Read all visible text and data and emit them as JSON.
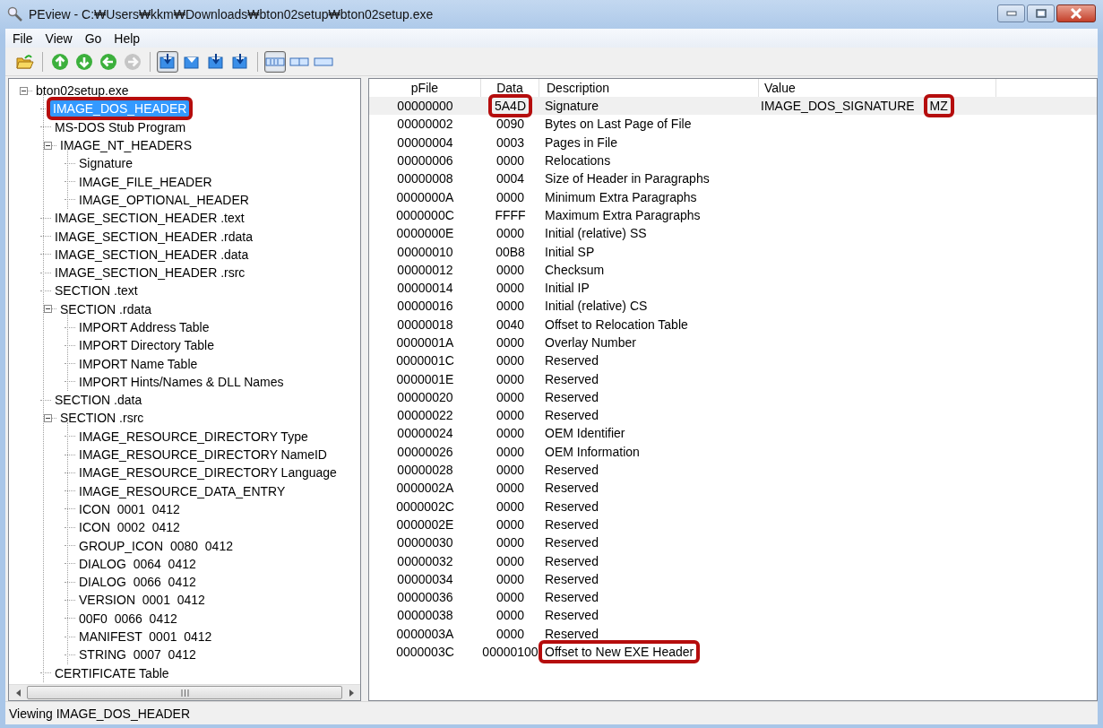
{
  "window": {
    "title": "PEview - C:₩Users₩kkm₩Downloads₩bton02setup₩bton02setup.exe"
  },
  "menu": [
    "File",
    "View",
    "Go",
    "Help"
  ],
  "toolbar": [
    {
      "pressed": false,
      "disabled": false
    },
    {
      "pressed": false,
      "disabled": false
    },
    {
      "pressed": false,
      "disabled": false
    },
    {
      "pressed": false,
      "disabled": false
    },
    {
      "pressed": false,
      "disabled": true
    },
    {
      "pressed": true,
      "disabled": false
    },
    {
      "pressed": false,
      "disabled": false
    },
    {
      "pressed": false,
      "disabled": false
    },
    {
      "pressed": false,
      "disabled": false
    },
    {
      "pressed": true,
      "disabled": false
    },
    {
      "pressed": false,
      "disabled": false
    },
    {
      "pressed": false,
      "disabled": false
    }
  ],
  "tree": [
    {
      "label": "bton02setup.exe",
      "selected": false,
      "marked": false,
      "expanded": true,
      "children": [
        {
          "label": "IMAGE_DOS_HEADER",
          "selected": true,
          "marked": true
        },
        {
          "label": "MS-DOS Stub Program",
          "selected": false,
          "marked": false
        },
        {
          "label": "IMAGE_NT_HEADERS",
          "selected": false,
          "marked": false,
          "expanded": true,
          "children": [
            {
              "label": "Signature",
              "selected": false,
              "marked": false
            },
            {
              "label": "IMAGE_FILE_HEADER",
              "selected": false,
              "marked": false
            },
            {
              "label": "IMAGE_OPTIONAL_HEADER",
              "selected": false,
              "marked": false
            }
          ]
        },
        {
          "label": "IMAGE_SECTION_HEADER .text",
          "selected": false,
          "marked": false
        },
        {
          "label": "IMAGE_SECTION_HEADER .rdata",
          "selected": false,
          "marked": false
        },
        {
          "label": "IMAGE_SECTION_HEADER .data",
          "selected": false,
          "marked": false
        },
        {
          "label": "IMAGE_SECTION_HEADER .rsrc",
          "selected": false,
          "marked": false
        },
        {
          "label": "SECTION .text",
          "selected": false,
          "marked": false
        },
        {
          "label": "SECTION .rdata",
          "selected": false,
          "marked": false,
          "expanded": true,
          "children": [
            {
              "label": "IMPORT Address Table",
              "selected": false,
              "marked": false
            },
            {
              "label": "IMPORT Directory Table",
              "selected": false,
              "marked": false
            },
            {
              "label": "IMPORT Name Table",
              "selected": false,
              "marked": false
            },
            {
              "label": "IMPORT Hints/Names & DLL Names",
              "selected": false,
              "marked": false
            }
          ]
        },
        {
          "label": "SECTION .data",
          "selected": false,
          "marked": false
        },
        {
          "label": "SECTION .rsrc",
          "selected": false,
          "marked": false,
          "expanded": true,
          "children": [
            {
              "label": "IMAGE_RESOURCE_DIRECTORY Type",
              "selected": false,
              "marked": false
            },
            {
              "label": "IMAGE_RESOURCE_DIRECTORY NameID",
              "selected": false,
              "marked": false
            },
            {
              "label": "IMAGE_RESOURCE_DIRECTORY Language",
              "selected": false,
              "marked": false
            },
            {
              "label": "IMAGE_RESOURCE_DATA_ENTRY",
              "selected": false,
              "marked": false
            },
            {
              "label": "ICON  0001  0412",
              "selected": false,
              "marked": false
            },
            {
              "label": "ICON  0002  0412",
              "selected": false,
              "marked": false
            },
            {
              "label": "GROUP_ICON  0080  0412",
              "selected": false,
              "marked": false
            },
            {
              "label": "DIALOG  0064  0412",
              "selected": false,
              "marked": false
            },
            {
              "label": "DIALOG  0066  0412",
              "selected": false,
              "marked": false
            },
            {
              "label": "VERSION  0001  0412",
              "selected": false,
              "marked": false
            },
            {
              "label": "00F0  0066  0412",
              "selected": false,
              "marked": false
            },
            {
              "label": "MANIFEST  0001  0412",
              "selected": false,
              "marked": false
            },
            {
              "label": "STRING  0007  0412",
              "selected": false,
              "marked": false
            }
          ]
        },
        {
          "label": "CERTIFICATE Table",
          "selected": false,
          "marked": false
        }
      ]
    }
  ],
  "table": {
    "columns": [
      "pFile",
      "Data",
      "Description",
      "Value"
    ],
    "rows": [
      {
        "pfile": "00000000",
        "data": "5A4D",
        "description": "Signature",
        "value": "IMAGE_DOS_SIGNATURE",
        "value_2": "MZ",
        "selected": true,
        "data_marked": true,
        "description_marked": false,
        "value_marked": true
      },
      {
        "pfile": "00000002",
        "data": "0090",
        "description": "Bytes on Last Page of File",
        "selected": false,
        "data_marked": false,
        "description_marked": false
      },
      {
        "pfile": "00000004",
        "data": "0003",
        "description": "Pages in File",
        "selected": false,
        "data_marked": false,
        "description_marked": false
      },
      {
        "pfile": "00000006",
        "data": "0000",
        "description": "Relocations",
        "selected": false,
        "data_marked": false,
        "description_marked": false
      },
      {
        "pfile": "00000008",
        "data": "0004",
        "description": "Size of Header in Paragraphs",
        "selected": false,
        "data_marked": false,
        "description_marked": false
      },
      {
        "pfile": "0000000A",
        "data": "0000",
        "description": "Minimum Extra Paragraphs",
        "selected": false,
        "data_marked": false,
        "description_marked": false
      },
      {
        "pfile": "0000000C",
        "data": "FFFF",
        "description": "Maximum Extra Paragraphs",
        "selected": false,
        "data_marked": false,
        "description_marked": false
      },
      {
        "pfile": "0000000E",
        "data": "0000",
        "description": "Initial (relative) SS",
        "selected": false,
        "data_marked": false,
        "description_marked": false
      },
      {
        "pfile": "00000010",
        "data": "00B8",
        "description": "Initial SP",
        "selected": false,
        "data_marked": false,
        "description_marked": false
      },
      {
        "pfile": "00000012",
        "data": "0000",
        "description": "Checksum",
        "selected": false,
        "data_marked": false,
        "description_marked": false
      },
      {
        "pfile": "00000014",
        "data": "0000",
        "description": "Initial IP",
        "selected": false,
        "data_marked": false,
        "description_marked": false
      },
      {
        "pfile": "00000016",
        "data": "0000",
        "description": "Initial (relative) CS",
        "selected": false,
        "data_marked": false,
        "description_marked": false
      },
      {
        "pfile": "00000018",
        "data": "0040",
        "description": "Offset to Relocation Table",
        "selected": false,
        "data_marked": false,
        "description_marked": false
      },
      {
        "pfile": "0000001A",
        "data": "0000",
        "description": "Overlay Number",
        "selected": false,
        "data_marked": false,
        "description_marked": false
      },
      {
        "pfile": "0000001C",
        "data": "0000",
        "description": "Reserved",
        "selected": false,
        "data_marked": false,
        "description_marked": false
      },
      {
        "pfile": "0000001E",
        "data": "0000",
        "description": "Reserved",
        "selected": false,
        "data_marked": false,
        "description_marked": false
      },
      {
        "pfile": "00000020",
        "data": "0000",
        "description": "Reserved",
        "selected": false,
        "data_marked": false,
        "description_marked": false
      },
      {
        "pfile": "00000022",
        "data": "0000",
        "description": "Reserved",
        "selected": false,
        "data_marked": false,
        "description_marked": false
      },
      {
        "pfile": "00000024",
        "data": "0000",
        "description": "OEM Identifier",
        "selected": false,
        "data_marked": false,
        "description_marked": false
      },
      {
        "pfile": "00000026",
        "data": "0000",
        "description": "OEM Information",
        "selected": false,
        "data_marked": false,
        "description_marked": false
      },
      {
        "pfile": "00000028",
        "data": "0000",
        "description": "Reserved",
        "selected": false,
        "data_marked": false,
        "description_marked": false
      },
      {
        "pfile": "0000002A",
        "data": "0000",
        "description": "Reserved",
        "selected": false,
        "data_marked": false,
        "description_marked": false
      },
      {
        "pfile": "0000002C",
        "data": "0000",
        "description": "Reserved",
        "selected": false,
        "data_marked": false,
        "description_marked": false
      },
      {
        "pfile": "0000002E",
        "data": "0000",
        "description": "Reserved",
        "selected": false,
        "data_marked": false,
        "description_marked": false
      },
      {
        "pfile": "00000030",
        "data": "0000",
        "description": "Reserved",
        "selected": false,
        "data_marked": false,
        "description_marked": false
      },
      {
        "pfile": "00000032",
        "data": "0000",
        "description": "Reserved",
        "selected": false,
        "data_marked": false,
        "description_marked": false
      },
      {
        "pfile": "00000034",
        "data": "0000",
        "description": "Reserved",
        "selected": false,
        "data_marked": false,
        "description_marked": false
      },
      {
        "pfile": "00000036",
        "data": "0000",
        "description": "Reserved",
        "selected": false,
        "data_marked": false,
        "description_marked": false
      },
      {
        "pfile": "00000038",
        "data": "0000",
        "description": "Reserved",
        "selected": false,
        "data_marked": false,
        "description_marked": false
      },
      {
        "pfile": "0000003A",
        "data": "0000",
        "description": "Reserved",
        "selected": false,
        "data_marked": false,
        "description_marked": false
      },
      {
        "pfile": "0000003C",
        "data": "00000100",
        "description": "Offset to New EXE Header",
        "selected": false,
        "data_marked": false,
        "description_marked": true
      }
    ]
  },
  "status_bar": "Viewing IMAGE_DOS_HEADER"
}
